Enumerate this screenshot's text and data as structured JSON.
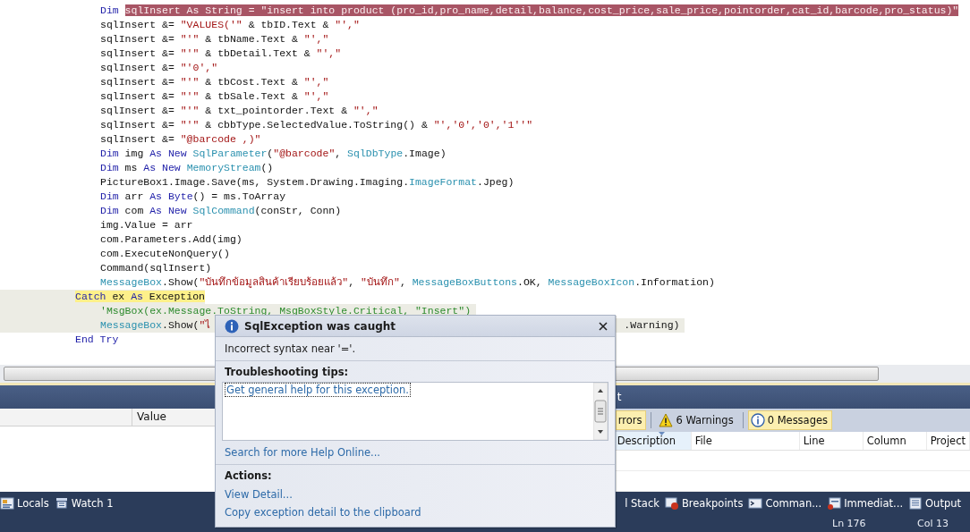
{
  "editor": {
    "lines": [
      {
        "kind": "statement",
        "current": false,
        "pending": false,
        "tokens": [
          {
            "kind": "kw",
            "text": "Dim "
          },
          {
            "kind": "sel",
            "text": "sqlInsert As String = \"insert into product (pro_id,pro_name,detail,balance,cost_price,sale_price,pointorder,cat_id,barcode,pro_status)\""
          }
        ]
      },
      {
        "kind": "statement",
        "current": false,
        "pending": false,
        "tokens": [
          {
            "kind": "plain",
            "text": "sqlInsert &= "
          },
          {
            "kind": "str",
            "text": "\"VALUES('\""
          },
          {
            "kind": "plain",
            "text": " & tbID.Text & "
          },
          {
            "kind": "str",
            "text": "\"',\""
          }
        ]
      },
      {
        "kind": "statement",
        "current": false,
        "pending": false,
        "tokens": [
          {
            "kind": "plain",
            "text": "sqlInsert &= "
          },
          {
            "kind": "str",
            "text": "\"'\""
          },
          {
            "kind": "plain",
            "text": " & tbName.Text & "
          },
          {
            "kind": "str",
            "text": "\"',\""
          }
        ]
      },
      {
        "kind": "statement",
        "current": false,
        "pending": false,
        "tokens": [
          {
            "kind": "plain",
            "text": "sqlInsert &= "
          },
          {
            "kind": "str",
            "text": "\"'\""
          },
          {
            "kind": "plain",
            "text": " & tbDetail.Text & "
          },
          {
            "kind": "str",
            "text": "\"',\""
          }
        ]
      },
      {
        "kind": "statement",
        "current": false,
        "pending": false,
        "tokens": [
          {
            "kind": "plain",
            "text": "sqlInsert &= "
          },
          {
            "kind": "str",
            "text": "\"'0',\""
          }
        ]
      },
      {
        "kind": "statement",
        "current": false,
        "pending": false,
        "tokens": [
          {
            "kind": "plain",
            "text": "sqlInsert &= "
          },
          {
            "kind": "str",
            "text": "\"'\""
          },
          {
            "kind": "plain",
            "text": " & tbCost.Text & "
          },
          {
            "kind": "str",
            "text": "\"',\""
          }
        ]
      },
      {
        "kind": "statement",
        "current": false,
        "pending": false,
        "tokens": [
          {
            "kind": "plain",
            "text": "sqlInsert &= "
          },
          {
            "kind": "str",
            "text": "\"'\""
          },
          {
            "kind": "plain",
            "text": " & tbSale.Text & "
          },
          {
            "kind": "str",
            "text": "\"',\""
          }
        ]
      },
      {
        "kind": "statement",
        "current": false,
        "pending": false,
        "tokens": [
          {
            "kind": "plain",
            "text": "sqlInsert &= "
          },
          {
            "kind": "str",
            "text": "\"'\""
          },
          {
            "kind": "plain",
            "text": " & txt_pointorder.Text & "
          },
          {
            "kind": "str",
            "text": "\"',\""
          }
        ]
      },
      {
        "kind": "statement",
        "current": false,
        "pending": false,
        "tokens": [
          {
            "kind": "plain",
            "text": "sqlInsert &= "
          },
          {
            "kind": "str",
            "text": "\"'\""
          },
          {
            "kind": "plain",
            "text": " & cbbType.SelectedValue.ToString() & "
          },
          {
            "kind": "str",
            "text": "\"','0','0','1''\""
          }
        ]
      },
      {
        "kind": "statement",
        "current": false,
        "pending": false,
        "tokens": [
          {
            "kind": "plain",
            "text": "sqlInsert &= "
          },
          {
            "kind": "str",
            "text": "\"@barcode ,)\""
          }
        ]
      },
      {
        "kind": "statement",
        "current": false,
        "pending": false,
        "tokens": [
          {
            "kind": "kw",
            "text": "Dim "
          },
          {
            "kind": "plain",
            "text": "img "
          },
          {
            "kind": "kw",
            "text": "As New "
          },
          {
            "kind": "type",
            "text": "SqlParameter"
          },
          {
            "kind": "plain",
            "text": "("
          },
          {
            "kind": "str",
            "text": "\"@barcode\""
          },
          {
            "kind": "plain",
            "text": ", "
          },
          {
            "kind": "type",
            "text": "SqlDbType"
          },
          {
            "kind": "plain",
            "text": ".Image)"
          }
        ]
      },
      {
        "kind": "statement",
        "current": false,
        "pending": false,
        "tokens": [
          {
            "kind": "kw",
            "text": "Dim "
          },
          {
            "kind": "plain",
            "text": "ms "
          },
          {
            "kind": "kw",
            "text": "As New "
          },
          {
            "kind": "type",
            "text": "MemoryStream"
          },
          {
            "kind": "plain",
            "text": "()"
          }
        ]
      },
      {
        "kind": "statement",
        "current": false,
        "pending": false,
        "tokens": [
          {
            "kind": "plain",
            "text": "PictureBox1.Image.Save(ms, System.Drawing.Imaging."
          },
          {
            "kind": "type",
            "text": "ImageFormat"
          },
          {
            "kind": "plain",
            "text": ".Jpeg)"
          }
        ]
      },
      {
        "kind": "statement",
        "current": false,
        "pending": false,
        "tokens": [
          {
            "kind": "kw",
            "text": "Dim "
          },
          {
            "kind": "plain",
            "text": "arr "
          },
          {
            "kind": "kw",
            "text": "As Byte"
          },
          {
            "kind": "plain",
            "text": "() = ms.ToArray"
          }
        ]
      },
      {
        "kind": "statement",
        "current": false,
        "pending": false,
        "tokens": [
          {
            "kind": "kw",
            "text": "Dim "
          },
          {
            "kind": "plain",
            "text": "com "
          },
          {
            "kind": "kw",
            "text": "As New "
          },
          {
            "kind": "type",
            "text": "SqlCommand"
          },
          {
            "kind": "plain",
            "text": "(conStr, Conn)"
          }
        ]
      },
      {
        "kind": "statement",
        "current": false,
        "pending": false,
        "tokens": [
          {
            "kind": "plain",
            "text": "img.Value = arr"
          }
        ]
      },
      {
        "kind": "statement",
        "current": false,
        "pending": false,
        "tokens": [
          {
            "kind": "plain",
            "text": "com.Parameters.Add(img)"
          }
        ]
      },
      {
        "kind": "statement",
        "current": false,
        "pending": false,
        "tokens": [
          {
            "kind": "plain",
            "text": "com.ExecuteNonQuery()"
          }
        ]
      },
      {
        "kind": "statement",
        "current": false,
        "pending": false,
        "tokens": [
          {
            "kind": "plain",
            "text": "Command(sqlInsert)"
          }
        ]
      },
      {
        "kind": "statement",
        "current": false,
        "pending": false,
        "tokens": [
          {
            "kind": "type",
            "text": "MessageBox"
          },
          {
            "kind": "plain",
            "text": ".Show("
          },
          {
            "kind": "str",
            "text": "\"บันทึกข้อมูลสินค้าเรียบร้อยแล้ว\""
          },
          {
            "kind": "plain",
            "text": ", "
          },
          {
            "kind": "str",
            "text": "\"บันทึก\""
          },
          {
            "kind": "plain",
            "text": ", "
          },
          {
            "kind": "type",
            "text": "MessageBoxButtons"
          },
          {
            "kind": "plain",
            "text": ".OK, "
          },
          {
            "kind": "type",
            "text": "MessageBoxIcon"
          },
          {
            "kind": "plain",
            "text": ".Information)"
          }
        ]
      },
      {
        "kind": "clause",
        "current": true,
        "pending": false,
        "tokens": [
          {
            "kind": "kw",
            "text": "Catch "
          },
          {
            "kind": "plain",
            "text": "ex "
          },
          {
            "kind": "kw",
            "text": "As "
          },
          {
            "kind": "plain",
            "text": "Exception"
          }
        ]
      },
      {
        "kind": "statement",
        "current": false,
        "pending": true,
        "tokens": [
          {
            "kind": "comment",
            "text": "'MsgBox(ex.Message.ToString, MsgBoxStyle.Critical, \"Insert\")"
          }
        ]
      },
      {
        "kind": "statement",
        "current": false,
        "pending": true,
        "tokens": [
          {
            "kind": "type",
            "text": "MessageBox"
          },
          {
            "kind": "plain",
            "text": ".Show("
          },
          {
            "kind": "str",
            "text": "\"ไ"
          },
          {
            "kind": "resume",
            "text": ".Warning)"
          }
        ]
      },
      {
        "kind": "clause",
        "current": false,
        "pending": false,
        "tokens": [
          {
            "kind": "kw",
            "text": "End Try"
          }
        ]
      }
    ]
  },
  "locals": {
    "value_column": "Value"
  },
  "error_list": {
    "title": "t",
    "filters": [
      {
        "kind": "errors",
        "label": "rrors",
        "on": true
      },
      {
        "kind": "warnings",
        "label": "6 Warnings",
        "on": false
      },
      {
        "kind": "messages",
        "label": "0 Messages",
        "on": true
      }
    ],
    "columns": [
      {
        "label": "Description",
        "sorted": true
      },
      {
        "label": "File",
        "sorted": false
      },
      {
        "label": "Line",
        "sorted": false
      },
      {
        "label": "Column",
        "sorted": false
      },
      {
        "label": "Project",
        "sorted": false
      }
    ]
  },
  "tool_tabs_left": [
    {
      "kind": "locals",
      "label": "Locals"
    },
    {
      "kind": "watch",
      "label": "Watch 1"
    }
  ],
  "tool_tabs_right": [
    {
      "kind": "none",
      "label": "l Stack"
    },
    {
      "kind": "breakpoints",
      "label": "Breakpoints"
    },
    {
      "kind": "command",
      "label": "Comman..."
    },
    {
      "kind": "immediate",
      "label": "Immediat..."
    },
    {
      "kind": "output",
      "label": "Output"
    }
  ],
  "status_bar": {
    "line": "Ln 176",
    "column": "Col 13"
  },
  "exception_popup": {
    "title": "SqlException was caught",
    "message": "Incorrect syntax near '='.",
    "tips_heading": "Troubleshooting tips:",
    "tips": [
      "Get general help for this exception."
    ],
    "help_link": "Search for more Help Online...",
    "actions_heading": "Actions:",
    "actions": [
      "View Detail...",
      "Copy exception detail to the clipboard"
    ]
  }
}
